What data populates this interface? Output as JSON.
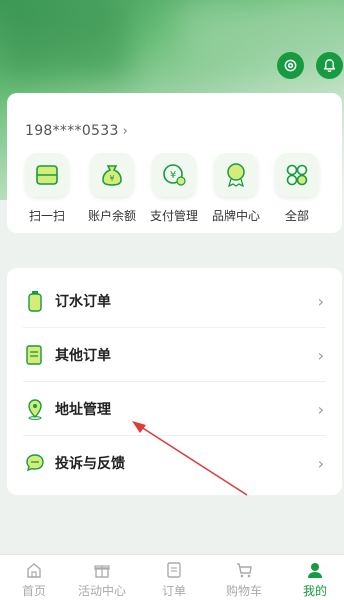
{
  "header": {
    "settings_icon": "settings-icon",
    "bell_icon": "bell-icon"
  },
  "profile": {
    "phone": "198****0533",
    "chevron": "›"
  },
  "quick_actions": [
    {
      "label": "扫一扫",
      "icon": "scan-icon"
    },
    {
      "label": "账户余额",
      "icon": "money-bag-icon"
    },
    {
      "label": "支付管理",
      "icon": "payment-icon"
    },
    {
      "label": "品牌中心",
      "icon": "brand-badge-icon"
    },
    {
      "label": "全部",
      "icon": "all-grid-icon"
    }
  ],
  "menu": [
    {
      "label": "订水订单",
      "icon": "water-bottle-icon"
    },
    {
      "label": "其他订单",
      "icon": "order-list-icon"
    },
    {
      "label": "地址管理",
      "icon": "location-pin-icon"
    },
    {
      "label": "投诉与反馈",
      "icon": "feedback-bubble-icon"
    }
  ],
  "tabbar": [
    {
      "label": "首页",
      "icon": "home-icon",
      "active": false
    },
    {
      "label": "活动中心",
      "icon": "gift-icon",
      "active": false
    },
    {
      "label": "订单",
      "icon": "order-icon",
      "active": false
    },
    {
      "label": "购物车",
      "icon": "cart-icon",
      "active": false
    },
    {
      "label": "我的",
      "icon": "user-icon",
      "active": true
    }
  ],
  "colors": {
    "brand_green": "#169b41",
    "annotation_red": "#e03a3a"
  }
}
